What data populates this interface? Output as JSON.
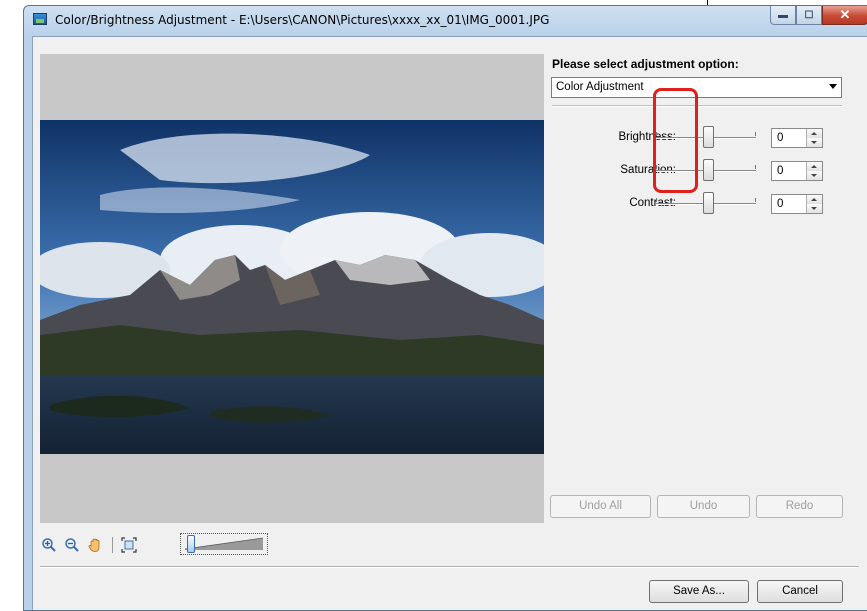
{
  "window": {
    "title": "Color/Brightness Adjustment - E:\\Users\\CANON\\Pictures\\xxxx_xx_01\\IMG_0001.JPG",
    "controls": {
      "minimize": "▬",
      "maximize": "☐",
      "close": "✕"
    }
  },
  "panel": {
    "option_label": "Please select adjustment option:",
    "option_selected": "Color Adjustment",
    "sliders": [
      {
        "label": "Brightness:",
        "value": "0"
      },
      {
        "label": "Saturation:",
        "value": "0"
      },
      {
        "label": "Contrast:",
        "value": "0"
      }
    ],
    "highlight_color": "#e0201a"
  },
  "history_buttons": {
    "undo_all": "Undo All",
    "undo": "Undo",
    "redo": "Redo"
  },
  "footer": {
    "save_as": "Save As...",
    "cancel": "Cancel"
  },
  "toolbar": {
    "icons": [
      "zoom-in-icon",
      "zoom-out-icon",
      "hand-pan-icon",
      "fit-to-window-icon"
    ]
  }
}
